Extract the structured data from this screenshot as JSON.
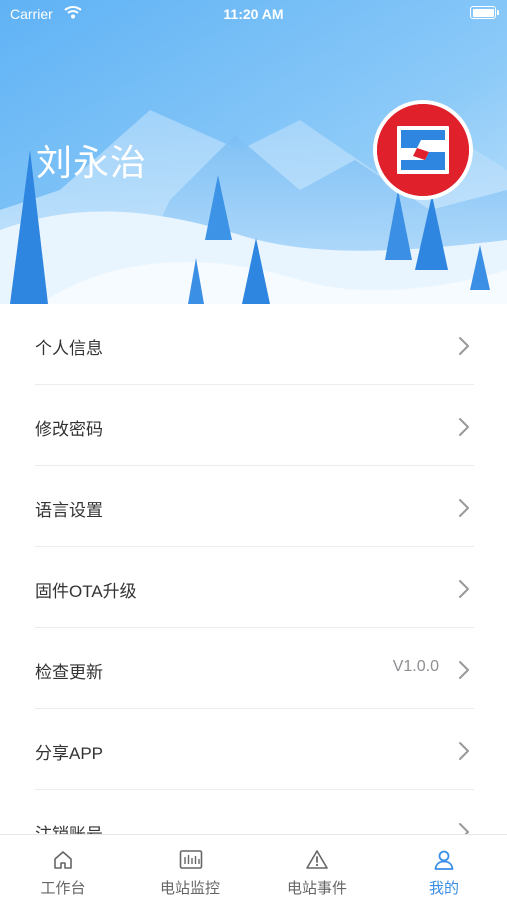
{
  "status_bar": {
    "carrier": "Carrier",
    "time": "11:20 AM"
  },
  "profile": {
    "name": "刘永治",
    "avatar_icon": "brand-logo-icon",
    "avatar_color": "#e0202a"
  },
  "menu": {
    "items": [
      {
        "label": "个人信息",
        "value": ""
      },
      {
        "label": "修改密码",
        "value": ""
      },
      {
        "label": "语言设置",
        "value": ""
      },
      {
        "label": "固件OTA升级",
        "value": ""
      },
      {
        "label": "检查更新",
        "value": "V1.0.0"
      },
      {
        "label": "分享APP",
        "value": ""
      },
      {
        "label": "注销账号",
        "value": ""
      }
    ]
  },
  "tabbar": {
    "tabs": [
      {
        "label": "工作台",
        "icon": "home-icon"
      },
      {
        "label": "电站监控",
        "icon": "monitor-icon"
      },
      {
        "label": "电站事件",
        "icon": "warning-icon"
      },
      {
        "label": "我的",
        "icon": "user-icon"
      }
    ],
    "active_index": 3,
    "accent_color": "#3a8ee6"
  }
}
